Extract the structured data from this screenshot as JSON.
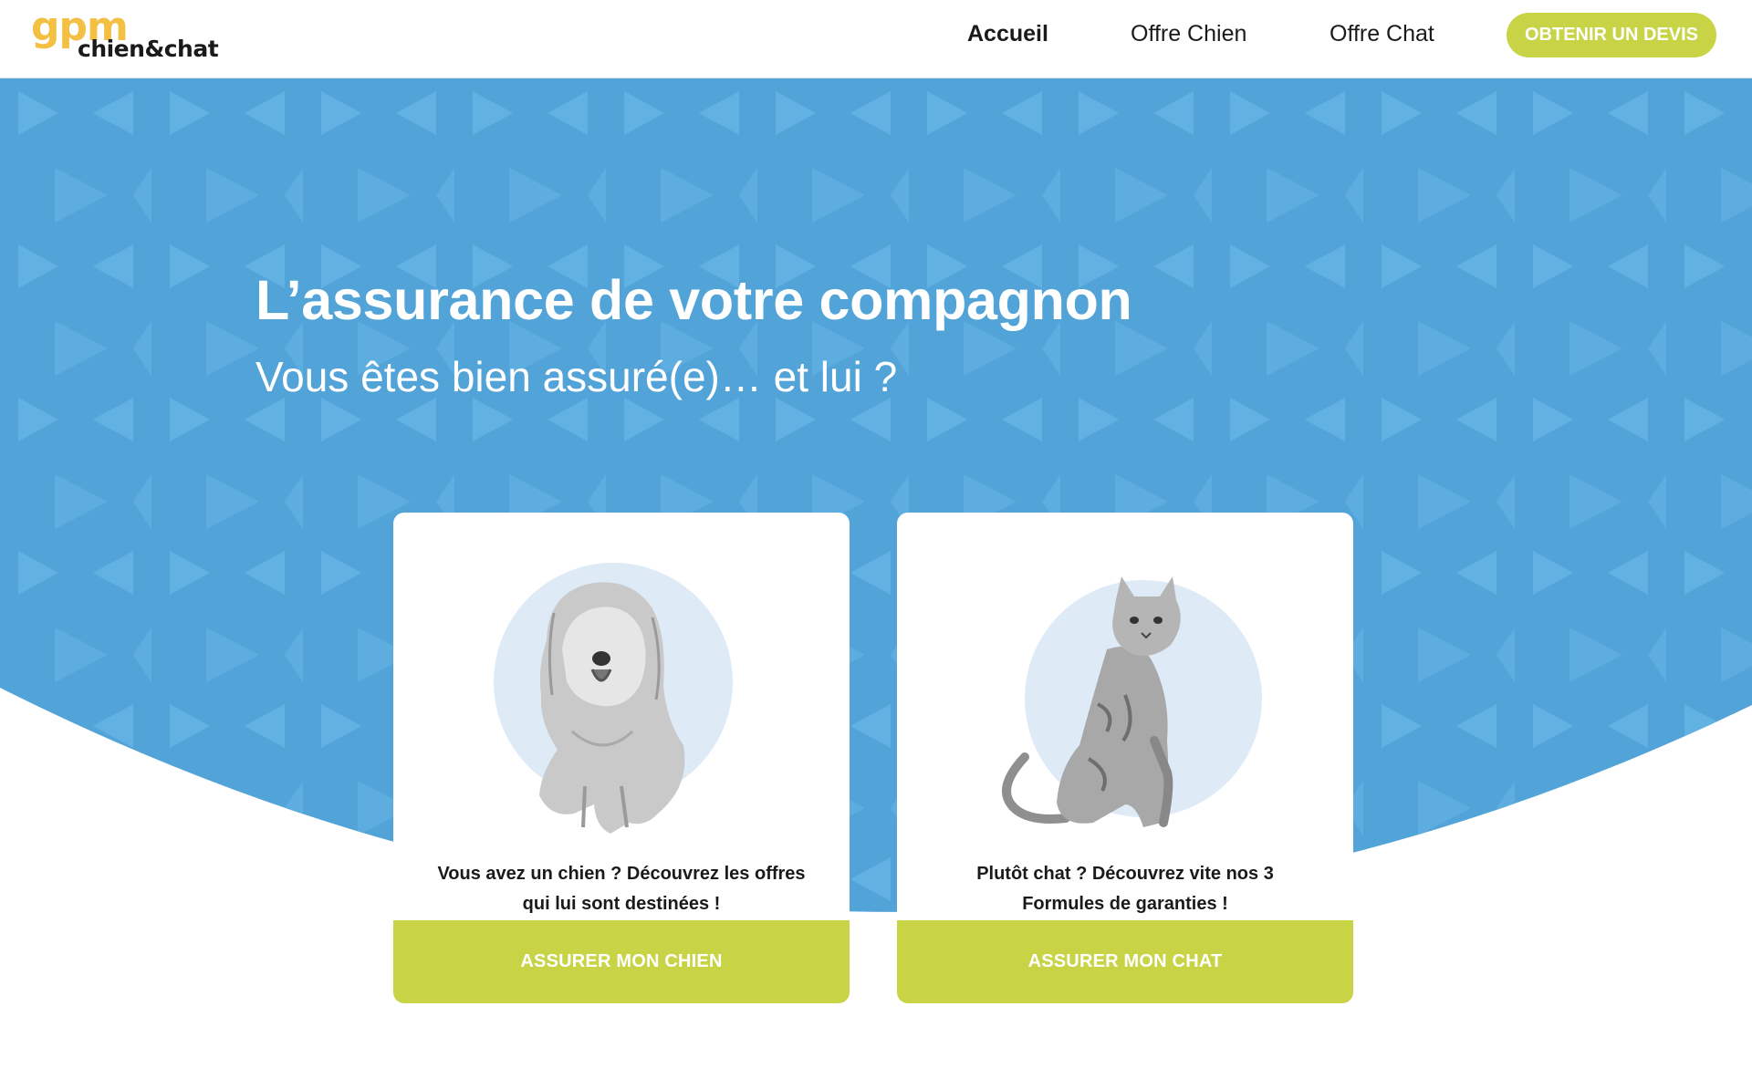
{
  "header": {
    "logo": {
      "brand": "gpm",
      "tagline": "chien&chat"
    },
    "nav": [
      {
        "label": "Accueil",
        "active": true
      },
      {
        "label": "Offre Chien",
        "active": false
      },
      {
        "label": "Offre Chat",
        "active": false
      }
    ],
    "cta_label": "OBTENIR UN DEVIS"
  },
  "hero": {
    "title": "L’assurance de votre compagnon",
    "subtitle": "Vous êtes bien assuré(e)… et lui ?"
  },
  "cards": [
    {
      "text": "Vous avez un chien ? Découvrez les offres qui lui sont destinées !",
      "button_label": "ASSURER MON CHIEN",
      "image_icon": "dog-illustration"
    },
    {
      "text": "Plutôt chat ? Découvrez vite nos 3 Formules de garanties !",
      "button_label": "ASSURER MON CHAT",
      "image_icon": "cat-illustration"
    }
  ],
  "colors": {
    "hero_blue": "#52a3d8",
    "pattern_light": "#62b1e3",
    "accent_green": "#c8d445",
    "logo_yellow": "#f3c043",
    "circle_bg": "#deebf7"
  }
}
